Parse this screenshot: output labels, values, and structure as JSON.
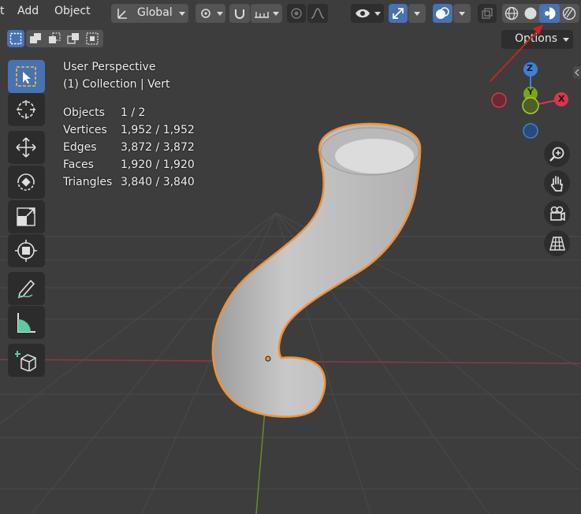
{
  "header": {
    "menu": [
      "t",
      "Add",
      "Object"
    ],
    "orientation": "Global",
    "options_label": "Options"
  },
  "overlay": {
    "view_name": "User Perspective",
    "collection": "(1) Collection | Vert",
    "stats": [
      {
        "label": "Objects",
        "value": "1 / 2"
      },
      {
        "label": "Vertices",
        "value": "1,952 / 1,952"
      },
      {
        "label": "Edges",
        "value": "3,872 / 3,872"
      },
      {
        "label": "Faces",
        "value": "1,920 / 1,920"
      },
      {
        "label": "Triangles",
        "value": "3,840 / 3,840"
      }
    ]
  },
  "gizmo": {
    "z": "Z",
    "y": "Y",
    "x": "X"
  },
  "colors": {
    "accent": "#4772b3",
    "selection_outline": "#f29133",
    "axis_x": "#d8374f",
    "axis_y": "#7ca418",
    "axis_z": "#3b82d6",
    "annotation_arrow": "#d11f1f"
  },
  "icons": {
    "toolbar": [
      "select-box-icon",
      "cursor-icon",
      "move-icon",
      "rotate-icon",
      "scale-icon",
      "transform-icon",
      "annotate-icon",
      "measure-icon",
      "add-cube-icon"
    ],
    "navigation": [
      "zoom-icon",
      "pan-hand-icon",
      "camera-icon",
      "grid-view-icon"
    ],
    "shading": [
      "wireframe-shading-icon",
      "solid-shading-icon",
      "material-preview-icon",
      "rendered-shading-icon"
    ]
  }
}
